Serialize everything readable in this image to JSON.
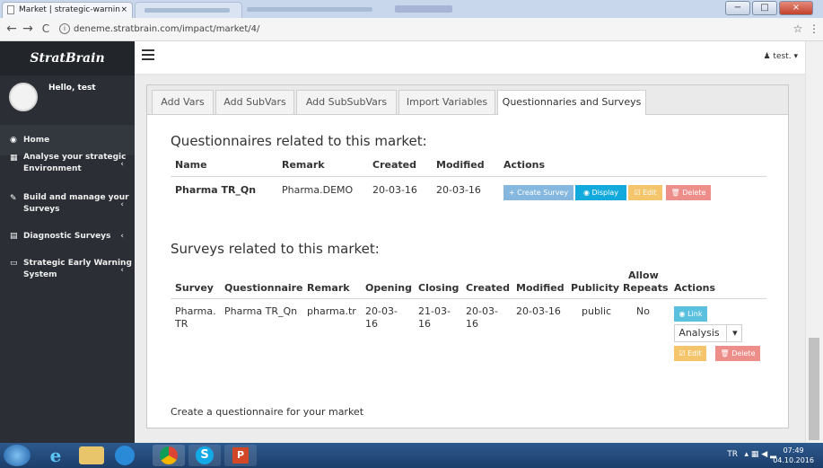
{
  "browser": {
    "tab_title": "Market | strategic-warnin",
    "tab_close": "×",
    "url": "deneme.stratbrain.com/impact/market/4/",
    "nav_back": "←",
    "nav_forward": "→",
    "nav_reload": "C",
    "info": "i",
    "star": "☆",
    "menu": "⋮",
    "win_min": "−",
    "win_max": "□",
    "win_close": "×"
  },
  "sidebar": {
    "brand": "StratBrain",
    "greeting": "Hello, test",
    "items": [
      {
        "label": "Home",
        "icon": "dashboard-icon",
        "glyph": "◉"
      },
      {
        "label": "Analyse your strategic Environment",
        "icon": "chart-icon",
        "glyph": "▦",
        "chevron": "‹"
      },
      {
        "label": "Build and manage your Surveys",
        "icon": "edit-icon",
        "glyph": "✎",
        "chevron": "‹"
      },
      {
        "label": "Diagnostic Surveys",
        "icon": "calendar-icon",
        "glyph": "▤",
        "chevron": "‹"
      },
      {
        "label": "Strategic Early Warning System",
        "icon": "monitor-icon",
        "glyph": "▭",
        "chevron": "‹"
      }
    ]
  },
  "topbar": {
    "menu_icon": "hamburger-icon",
    "user": "test",
    "user_glyph": "♟",
    "caret": "▾"
  },
  "tabs": [
    "Add Vars",
    "Add SubVars",
    "Add SubSubVars",
    "Import Variables",
    "Questionnaries and Surveys"
  ],
  "questionnaires": {
    "heading": "Questionnaires related to this market:",
    "columns": [
      "Name",
      "Remark",
      "Created",
      "Modified",
      "Actions"
    ],
    "rows": [
      {
        "name": "Pharma TR_Qn",
        "remark": "Pharma.DEMO",
        "created": "20-03-16",
        "modified": "20-03-16"
      }
    ],
    "buttons": {
      "create": "+ Create Survey",
      "display": "◉ Display",
      "edit": "☑ Edit",
      "delete": "🗑 Delete"
    }
  },
  "surveys": {
    "heading": "Surveys related to this market:",
    "columns": [
      "Survey",
      "Questionnaire",
      "Remark",
      "Opening",
      "Closing",
      "Created",
      "Modified",
      "Publicity",
      "Allow",
      "Repeats",
      "Actions"
    ],
    "rows": [
      {
        "survey_1": "Pharma.",
        "survey_2": "TR",
        "questionnaire": "Pharma TR_Qn",
        "remark": "pharma.tr",
        "opening_1": "20-03-",
        "opening_2": "16",
        "closing_1": "21-03-",
        "closing_2": "16",
        "created_1": "20-03-",
        "created_2": "16",
        "modified": "20-03-16",
        "publicity": "public",
        "allow_repeats": "No"
      }
    ],
    "buttons": {
      "link": "◉ Link",
      "analysis": "Analysis",
      "analysis_caret": "▾",
      "edit": "☑ Edit",
      "delete": "🗑 Delete"
    }
  },
  "footer_text": "Create a questionnaire for your market",
  "taskbar": {
    "lang": "TR",
    "time": "07:49",
    "date": "04.10.2016",
    "tray": "▴ ▦ ◀ ▂"
  },
  "colors": {
    "sidebar": "#2b2f35",
    "display_button": "#12a9dc",
    "edit_button": "#f5c56c",
    "delete_button": "#ee8e8a",
    "create_button": "#86b8df"
  }
}
